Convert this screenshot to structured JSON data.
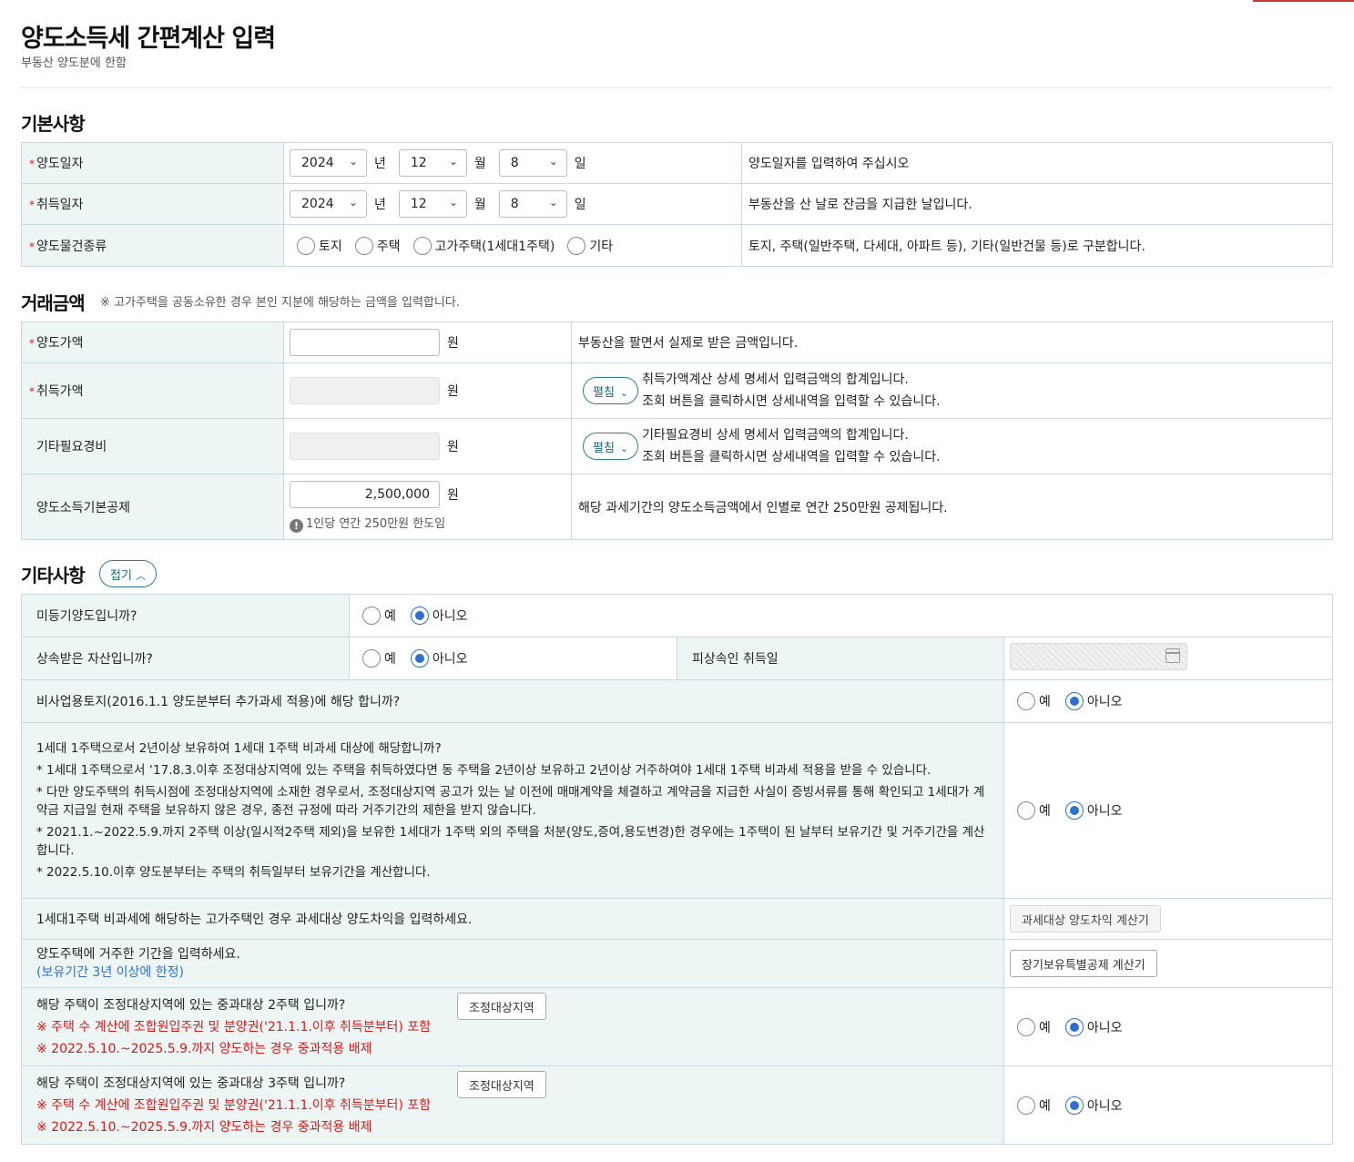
{
  "header": {
    "title": "양도소득세 간편계산 입력",
    "subtitle": "부동산 양도분에 한함"
  },
  "basic": {
    "title": "기본사항",
    "required_mark": "*",
    "rows": [
      {
        "label": "양도일자",
        "year": "2024",
        "month": "12",
        "day": "8",
        "desc": "양도일자를 입력하여 주십시오"
      },
      {
        "label": "취득일자",
        "year": "2024",
        "month": "12",
        "day": "8",
        "desc": "부동산을 산 날로 잔금을 지급한 날입니다."
      }
    ],
    "units": {
      "year": "년",
      "month": "월",
      "day": "일"
    },
    "type_row": {
      "label": "양도물건종류",
      "options": [
        "토지",
        "주택",
        "고가주택(1세대1주택)",
        "기타"
      ],
      "desc": "토지, 주택(일반주택, 다세대, 아파트 등), 기타(일반건물 등)로 구분합니다."
    }
  },
  "amount": {
    "title": "거래금액",
    "note": "※ 고가주택을 공동소유한 경우 본인 지분에 해당하는 금액을 입력합니다.",
    "unit": "원",
    "sale": {
      "label": "양도가액",
      "value": "",
      "desc": "부동산을 팔면서 실제로 받은 금액입니다."
    },
    "acquire": {
      "label": "취득가액",
      "button": "펼침",
      "desc1": "취득가액계산 상세 명세서 입력금액의 합계입니다.",
      "desc2": "조회 버튼을 클릭하시면 상세내역을 입력할 수 있습니다."
    },
    "expense": {
      "label": "기타필요경비",
      "button": "펼침",
      "desc1": "기타필요경비 상세 명세서 입력금액의 합계입니다.",
      "desc2": "조회 버튼을 클릭하시면 상세내역을 입력할 수 있습니다."
    },
    "deduction": {
      "label": "양도소득기본공제",
      "value": "2,500,000",
      "hint": "1인당 연간 250만원 한도임",
      "desc": "해당 과세기간의 양도소득금액에서 인별로 연간 250만원 공제됩니다."
    }
  },
  "other": {
    "title": "기타사항",
    "fold_button": "접기",
    "yes": "예",
    "no": "아니오",
    "q_unregistered": "미등기양도입니까?",
    "q_inherited": "상속받은 자산입니까?",
    "inherit_date_label": "피상속인 취득일",
    "q_nonbusiness": "비사업용토지(2016.1.1 양도분부터 추가과세 적용)에 해당 합니까?",
    "q_one_house": {
      "title": "1세대 1주택으로서 2년이상 보유하여 1세대 1주택 비과세 대상에 해당합니까?",
      "note1": "* 1세대 1주택으로서 ‘17.8.3.이후 조정대상지역에 있는 주택을 취득하였다면 동 주택을 2년이상 보유하고 2년이상 거주하여야 1세대 1주택 비과세 적용을 받을 수 있습니다.",
      "note2": "* 다만 양도주택의 취득시점에 조정대상지역에 소재한 경우로서, 조정대상지역 공고가 있는 날 이전에 매매계약을 체결하고 계약금을 지급한 사실이 증빙서류를 통해 확인되고 1세대가 계약금 지급일 현재 주택을 보유하지 않은 경우, 종전 규정에 따라 거주기간의 제한을 받지 않습니다.",
      "note3": "* 2021.1.~2022.5.9.까지 2주택 이상(일시적2주택 제외)을 보유한 1세대가 1주택 외의 주택을 처분(양도,증여,용도변경)한 경우에는 1주택이 된 날부터 보유기간 및 거주기간을 계산합니다.",
      "note4": "* 2022.5.10.이후 양도분부터는 주택의 취득일부터 보유기간을 계산합니다."
    },
    "q_high_price": {
      "text": "1세대1주택 비과세에 해당하는 고가주택인 경우 과세대상 양도차익을 입력하세요.",
      "button": "과세대상 양도차익 계산기"
    },
    "q_residence": {
      "text": "양도주택에 거주한 기간을 입력하세요.",
      "sub": "(보유기간 3년 이상에 한정)",
      "button": "장기보유특별공제 계산기"
    },
    "q_two_house": {
      "text": "해당 주택이 조정대상지역에 있는 중과대상 2주택 입니까?",
      "button": "조정대상지역",
      "red1": "※ 주택 수 계산에 조합원입주권 및 분양권('21.1.1.이후 취득분부터) 포함",
      "red2": "※ 2022.5.10.~2025.5.9.까지 양도하는 경우 중과적용 배제"
    },
    "q_three_house": {
      "text": "해당 주택이 조정대상지역에 있는 중과대상 3주택 입니까?",
      "button": "조정대상지역",
      "red1": "※ 주택 수 계산에 조합원입주권 및 분양권('21.1.1.이후 취득분부터) 포함",
      "red2": "※ 2022.5.10.~2025.5.9.까지 양도하는 경우 중과적용 배제"
    }
  },
  "icons": {
    "chevron": "chevron-down-icon",
    "info": "info-icon",
    "calendar": "calendar-icon"
  },
  "colors": {
    "accent": "#2f6fcf",
    "teal": "#1c6873",
    "header_bg": "#eef6f5",
    "required": "#d61a1a"
  }
}
